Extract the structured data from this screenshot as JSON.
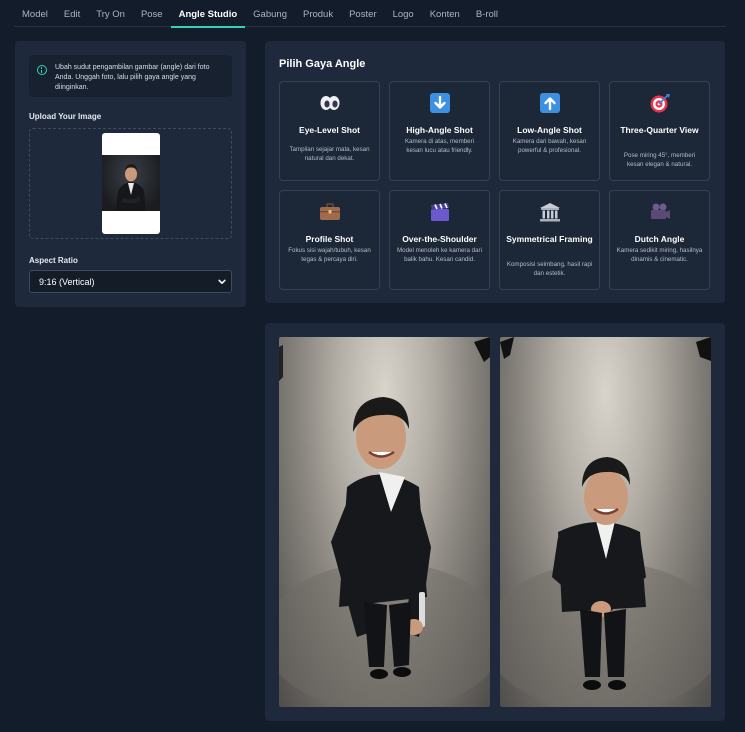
{
  "nav": {
    "tabs": [
      {
        "label": "Model"
      },
      {
        "label": "Edit"
      },
      {
        "label": "Try On"
      },
      {
        "label": "Pose"
      },
      {
        "label": "Angle Studio"
      },
      {
        "label": "Gabung"
      },
      {
        "label": "Produk"
      },
      {
        "label": "Poster"
      },
      {
        "label": "Logo"
      },
      {
        "label": "Konten"
      },
      {
        "label": "B-roll"
      }
    ],
    "active": "Angle Studio"
  },
  "left": {
    "info": "Ubah sudut pengambilan gambar (angle) dari foto Anda. Unggah foto, lalu pilih gaya angle yang diinginkan.",
    "upload_label": "Upload Your Image",
    "aspect_label": "Aspect Ratio",
    "aspect_value": "9:16 (Vertical)"
  },
  "styles": {
    "title": "Pilih Gaya Angle",
    "cards": [
      {
        "title": "Eye-Level Shot",
        "desc": "Tampilan sejajar mata, kesan natural dan dekat.",
        "icon": "eyes-icon"
      },
      {
        "title": "High-Angle Shot",
        "desc": "Kamera di atas, memberi kesan lucu atau friendly.",
        "icon": "down-arrow-icon"
      },
      {
        "title": "Low-Angle Shot",
        "desc": "Kamera dari bawah, kesan powerful & profesional.",
        "icon": "up-arrow-icon"
      },
      {
        "title": "Three-Quarter View",
        "desc": "Pose miring 45°, memberi kesan elegan & natural.",
        "icon": "target-icon"
      },
      {
        "title": "Profile Shot",
        "desc": "Fokus sisi wajah/tubuh, kesan tegas & percaya diri.",
        "icon": "briefcase-icon"
      },
      {
        "title": "Over-the-Shoulder",
        "desc": "Model menoleh ke kamera dari balik bahu. Kesan candid.",
        "icon": "clapper-icon"
      },
      {
        "title": "Symmetrical Framing",
        "desc": "Komposisi seimbang, hasil rapi dan estetik.",
        "icon": "classical-building-icon"
      },
      {
        "title": "Dutch Angle",
        "desc": "Kamera sedikit miring, hasilnya dinamis & cinematic.",
        "icon": "movie-camera-icon"
      }
    ]
  },
  "colors": {
    "accent": "#35d2b4",
    "background": "#131c2b",
    "panel": "#1e2a3b"
  }
}
